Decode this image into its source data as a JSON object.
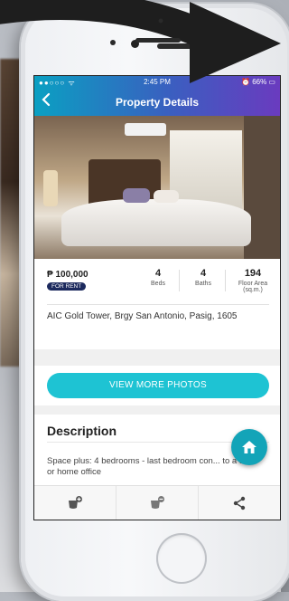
{
  "status": {
    "signal": "●●○○○ ᯤ",
    "time": "2:45 PM",
    "battery": "⏰ 66% ▭"
  },
  "nav": {
    "title": "Property Details",
    "back_icon": "back-arrow-icon"
  },
  "listing": {
    "price": "₱ 100,000",
    "badge": "FOR RENT",
    "beds": {
      "value": "4",
      "label": "Beds"
    },
    "baths": {
      "value": "4",
      "label": "Baths"
    },
    "floor_area": {
      "value": "194",
      "label": "Floor Area",
      "unit": "(sq.m.)"
    },
    "address": "AIC Gold Tower, Brgy San Antonio, Pasig, 1605"
  },
  "photos": {
    "button_label": "VIEW MORE PHOTOS"
  },
  "description": {
    "title": "Description",
    "text": "Space plus: 4 bedrooms - last bedroom con... to a den or home office"
  },
  "fab": {
    "icon": "home-icon"
  },
  "bottom_tabs": [
    {
      "icon": "add-shortlist-icon"
    },
    {
      "icon": "remove-shortlist-icon"
    },
    {
      "icon": "share-icon"
    }
  ],
  "colors": {
    "accent": "#1ec3d3",
    "nav_start": "#0aa0c2",
    "nav_end": "#6a3bbf",
    "badge": "#1c2a5e",
    "fab": "#13a4b8"
  }
}
